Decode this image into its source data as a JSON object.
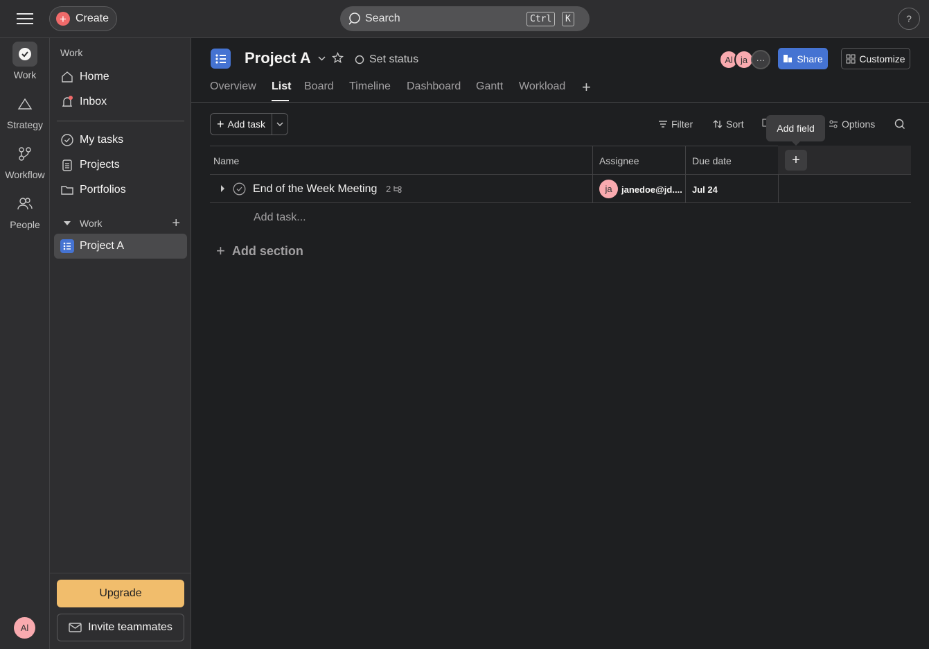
{
  "topbar": {
    "create_label": "Create",
    "search_placeholder": "Search",
    "kbd_ctrl": "Ctrl",
    "kbd_k": "K",
    "help_label": "?"
  },
  "rail": {
    "items": [
      {
        "label": "Work",
        "icon": "check-circle-icon"
      },
      {
        "label": "Strategy",
        "icon": "triangle-icon"
      },
      {
        "label": "Workflow",
        "icon": "workflow-icon"
      },
      {
        "label": "People",
        "icon": "people-icon"
      }
    ],
    "avatar_initials": "Al"
  },
  "sidebar": {
    "header": "Work",
    "items": [
      {
        "label": "Home",
        "icon": "home-icon"
      },
      {
        "label": "Inbox",
        "icon": "bell-icon"
      },
      {
        "label": "My tasks",
        "icon": "check-circle-icon"
      },
      {
        "label": "Projects",
        "icon": "clipboard-icon"
      },
      {
        "label": "Portfolios",
        "icon": "folder-icon"
      }
    ],
    "section_label": "Work",
    "project_label": "Project A",
    "upgrade_label": "Upgrade",
    "invite_label": "Invite teammates"
  },
  "project": {
    "title": "Project A",
    "set_status": "Set status",
    "tabs": [
      "Overview",
      "List",
      "Board",
      "Timeline",
      "Dashboard",
      "Gantt",
      "Workload"
    ],
    "active_tab": "List",
    "members": [
      "Al",
      "ja"
    ],
    "share_label": "Share",
    "customize_label": "Customize"
  },
  "toolbar": {
    "add_task_label": "Add task",
    "filter_label": "Filter",
    "sort_label": "Sort",
    "options_label": "Options",
    "tooltip": "Add field"
  },
  "table": {
    "columns": [
      "Name",
      "Assignee",
      "Due date"
    ],
    "rows": [
      {
        "name": "End of the Week Meeting",
        "subtasks": "2",
        "assignee_initials": "ja",
        "assignee": "janedoe@jd....",
        "due": "Jul 24"
      }
    ],
    "add_task_placeholder": "Add task...",
    "add_section_label": "Add section"
  },
  "colors": {
    "accent_blue": "#4573d2",
    "create_red": "#f06a6a",
    "upgrade_orange": "#f1bd6c",
    "avatar_pink": "#f9aaaf"
  }
}
